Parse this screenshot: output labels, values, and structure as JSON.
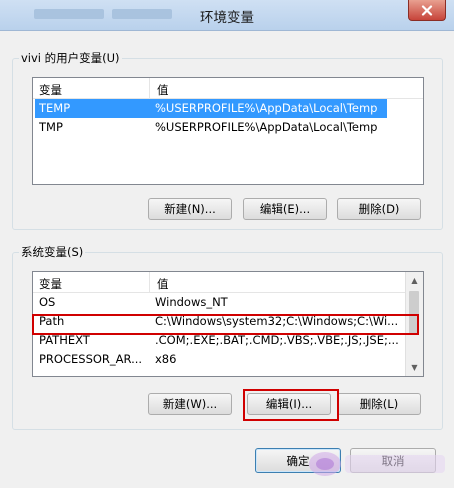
{
  "window": {
    "title": "环境变量"
  },
  "user_vars": {
    "legend": "vivi 的用户变量(U)",
    "columns": [
      "变量",
      "值"
    ],
    "rows": [
      {
        "name": "TEMP",
        "value": "%USERPROFILE%\\AppData\\Local\\Temp",
        "selected": true
      },
      {
        "name": "TMP",
        "value": "%USERPROFILE%\\AppData\\Local\\Temp",
        "selected": false
      }
    ],
    "buttons": {
      "new": "新建(N)...",
      "edit": "编辑(E)...",
      "delete": "删除(D)"
    }
  },
  "system_vars": {
    "legend": "系统变量(S)",
    "columns": [
      "变量",
      "值"
    ],
    "rows": [
      {
        "name": "OS",
        "value": "Windows_NT"
      },
      {
        "name": "Path",
        "value": "C:\\Windows\\system32;C:\\Windows;C:\\Wi..."
      },
      {
        "name": "PATHEXT",
        "value": ".COM;.EXE;.BAT;.CMD;.VBS;.VBE;.JS;.JSE;..."
      },
      {
        "name": "PROCESSOR_AR...",
        "value": "x86"
      }
    ],
    "buttons": {
      "new": "新建(W)...",
      "edit": "编辑(I)...",
      "delete": "删除(L)"
    }
  },
  "footer": {
    "ok": "确定",
    "cancel": "取消"
  },
  "colors": {
    "selection": "#3399ff",
    "highlight_box": "#d00000",
    "title_bar": "#c4d9ef"
  },
  "icons": {
    "close": "close-icon"
  }
}
